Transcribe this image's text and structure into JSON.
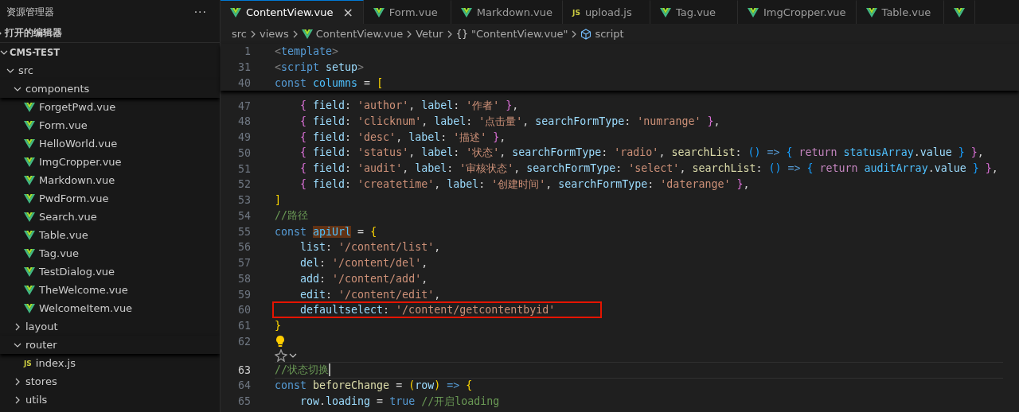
{
  "sidebar": {
    "title": "资源管理器",
    "more": "···",
    "sections": [
      {
        "label": "打开的编辑器",
        "expanded": false
      },
      {
        "label": "CMS-TEST",
        "expanded": true
      }
    ],
    "tree": [
      {
        "label": "src",
        "kind": "folder",
        "expanded": true,
        "children": [
          {
            "label": "components",
            "kind": "folder",
            "expanded": true,
            "children": [
              {
                "label": "ForgetPwd.vue",
                "kind": "vue"
              },
              {
                "label": "Form.vue",
                "kind": "vue"
              },
              {
                "label": "HelloWorld.vue",
                "kind": "vue"
              },
              {
                "label": "ImgCropper.vue",
                "kind": "vue"
              },
              {
                "label": "Markdown.vue",
                "kind": "vue"
              },
              {
                "label": "PwdForm.vue",
                "kind": "vue"
              },
              {
                "label": "Search.vue",
                "kind": "vue"
              },
              {
                "label": "Table.vue",
                "kind": "vue"
              },
              {
                "label": "Tag.vue",
                "kind": "vue"
              },
              {
                "label": "TestDialog.vue",
                "kind": "vue"
              },
              {
                "label": "TheWelcome.vue",
                "kind": "vue"
              },
              {
                "label": "WelcomeItem.vue",
                "kind": "vue"
              }
            ]
          },
          {
            "label": "layout",
            "kind": "folder",
            "expanded": false
          },
          {
            "label": "router",
            "kind": "folder",
            "expanded": true,
            "children": [
              {
                "label": "index.js",
                "kind": "js",
                "icon": "JS"
              }
            ]
          },
          {
            "label": "stores",
            "kind": "folder",
            "expanded": false
          },
          {
            "label": "utils",
            "kind": "folder",
            "expanded": false
          }
        ]
      }
    ]
  },
  "tabs": [
    {
      "label": "ContentView.vue",
      "kind": "vue",
      "selected": true,
      "close": "×"
    },
    {
      "label": "Form.vue",
      "kind": "vue",
      "selected": false
    },
    {
      "label": "Markdown.vue",
      "kind": "vue",
      "selected": false
    },
    {
      "label": "upload.js",
      "kind": "js",
      "icon": "JS",
      "selected": false
    },
    {
      "label": "Tag.vue",
      "kind": "vue",
      "selected": false
    },
    {
      "label": "ImgCropper.vue",
      "kind": "vue",
      "selected": false
    },
    {
      "label": "Table.vue",
      "kind": "vue",
      "selected": false
    },
    {
      "kind": "vue",
      "selected": false
    }
  ],
  "breadcrumb": [
    {
      "label": "src",
      "kind": "folder"
    },
    {
      "label": "views",
      "kind": "folder"
    },
    {
      "label": "ContentView.vue",
      "kind": "vue"
    },
    {
      "label": "Vetur",
      "kind": "plain"
    },
    {
      "label": "\"ContentView.vue\"",
      "kind": "object",
      "icon": "{}"
    },
    {
      "label": "script",
      "kind": "module"
    }
  ],
  "sticky": [
    {
      "number": "1",
      "tokens": [
        {
          "kind": "tag",
          "text": "<"
        },
        {
          "kind": "tn",
          "text": "template"
        },
        {
          "kind": "tag",
          "text": ">"
        }
      ]
    },
    {
      "number": "31",
      "tokens": [
        {
          "kind": "tag",
          "text": "<"
        },
        {
          "kind": "tn",
          "text": "script "
        },
        {
          "kind": "prop",
          "text": "setup"
        },
        {
          "kind": "tag",
          "text": ">"
        }
      ]
    },
    {
      "number": "40",
      "tokens": [
        {
          "kind": "kw",
          "text": "const "
        },
        {
          "kind": "var",
          "text": "columns"
        },
        {
          "kind": "punc",
          "text": " = "
        },
        {
          "kind": "b1",
          "text": "["
        }
      ]
    }
  ],
  "lines": [
    {
      "kind": "code",
      "number": "47",
      "tokens": [
        {
          "kind": "b2",
          "text": "    { "
        },
        {
          "kind": "prop",
          "text": "field"
        },
        {
          "kind": "punc",
          "text": ": "
        },
        {
          "kind": "str",
          "text": "'author'"
        },
        {
          "kind": "punc",
          "text": ", "
        },
        {
          "kind": "prop",
          "text": "label"
        },
        {
          "kind": "punc",
          "text": ": "
        },
        {
          "kind": "str",
          "text": "'作者'"
        },
        {
          "kind": "b2",
          "text": " }"
        },
        {
          "kind": "punc",
          "text": ","
        }
      ]
    },
    {
      "kind": "code",
      "number": "48",
      "tokens": [
        {
          "kind": "b2",
          "text": "    { "
        },
        {
          "kind": "prop",
          "text": "field"
        },
        {
          "kind": "punc",
          "text": ": "
        },
        {
          "kind": "str",
          "text": "'clicknum'"
        },
        {
          "kind": "punc",
          "text": ", "
        },
        {
          "kind": "prop",
          "text": "label"
        },
        {
          "kind": "punc",
          "text": ": "
        },
        {
          "kind": "str",
          "text": "'点击量'"
        },
        {
          "kind": "punc",
          "text": ", "
        },
        {
          "kind": "prop",
          "text": "searchFormType"
        },
        {
          "kind": "punc",
          "text": ": "
        },
        {
          "kind": "str",
          "text": "'numrange'"
        },
        {
          "kind": "b2",
          "text": " }"
        },
        {
          "kind": "punc",
          "text": ","
        }
      ]
    },
    {
      "kind": "code",
      "number": "49",
      "tokens": [
        {
          "kind": "b2",
          "text": "    { "
        },
        {
          "kind": "prop",
          "text": "field"
        },
        {
          "kind": "punc",
          "text": ": "
        },
        {
          "kind": "str",
          "text": "'desc'"
        },
        {
          "kind": "punc",
          "text": ", "
        },
        {
          "kind": "prop",
          "text": "label"
        },
        {
          "kind": "punc",
          "text": ": "
        },
        {
          "kind": "str",
          "text": "'描述'"
        },
        {
          "kind": "b2",
          "text": " }"
        },
        {
          "kind": "punc",
          "text": ","
        }
      ]
    },
    {
      "kind": "code",
      "number": "50",
      "tokens": [
        {
          "kind": "b2",
          "text": "    { "
        },
        {
          "kind": "prop",
          "text": "field"
        },
        {
          "kind": "punc",
          "text": ": "
        },
        {
          "kind": "str",
          "text": "'status'"
        },
        {
          "kind": "punc",
          "text": ", "
        },
        {
          "kind": "prop",
          "text": "label"
        },
        {
          "kind": "punc",
          "text": ": "
        },
        {
          "kind": "str",
          "text": "'状态'"
        },
        {
          "kind": "punc",
          "text": ", "
        },
        {
          "kind": "prop",
          "text": "searchFormType"
        },
        {
          "kind": "punc",
          "text": ": "
        },
        {
          "kind": "str",
          "text": "'radio'"
        },
        {
          "kind": "punc",
          "text": ", "
        },
        {
          "kind": "fn",
          "text": "searchList"
        },
        {
          "kind": "punc",
          "text": ": "
        },
        {
          "kind": "b3",
          "text": "()"
        },
        {
          "kind": "kw",
          "text": " => "
        },
        {
          "kind": "b3",
          "text": "{ "
        },
        {
          "kind": "ctl",
          "text": "return "
        },
        {
          "kind": "var",
          "text": "statusArray"
        },
        {
          "kind": "punc",
          "text": "."
        },
        {
          "kind": "prop",
          "text": "value"
        },
        {
          "kind": "b3",
          "text": " }"
        },
        {
          "kind": "b2",
          "text": " }"
        },
        {
          "kind": "punc",
          "text": ","
        }
      ]
    },
    {
      "kind": "code",
      "number": "51",
      "tokens": [
        {
          "kind": "b2",
          "text": "    { "
        },
        {
          "kind": "prop",
          "text": "field"
        },
        {
          "kind": "punc",
          "text": ": "
        },
        {
          "kind": "str",
          "text": "'audit'"
        },
        {
          "kind": "punc",
          "text": ", "
        },
        {
          "kind": "prop",
          "text": "label"
        },
        {
          "kind": "punc",
          "text": ": "
        },
        {
          "kind": "str",
          "text": "'审核状态'"
        },
        {
          "kind": "punc",
          "text": ", "
        },
        {
          "kind": "prop",
          "text": "searchFormType"
        },
        {
          "kind": "punc",
          "text": ": "
        },
        {
          "kind": "str",
          "text": "'select'"
        },
        {
          "kind": "punc",
          "text": ", "
        },
        {
          "kind": "fn",
          "text": "searchList"
        },
        {
          "kind": "punc",
          "text": ": "
        },
        {
          "kind": "b3",
          "text": "()"
        },
        {
          "kind": "kw",
          "text": " => "
        },
        {
          "kind": "b3",
          "text": "{ "
        },
        {
          "kind": "ctl",
          "text": "return "
        },
        {
          "kind": "var",
          "text": "auditArray"
        },
        {
          "kind": "punc",
          "text": "."
        },
        {
          "kind": "prop",
          "text": "value"
        },
        {
          "kind": "b3",
          "text": " }"
        },
        {
          "kind": "b2",
          "text": " }"
        },
        {
          "kind": "punc",
          "text": ","
        }
      ]
    },
    {
      "kind": "code",
      "number": "52",
      "tokens": [
        {
          "kind": "b2",
          "text": "    { "
        },
        {
          "kind": "prop",
          "text": "field"
        },
        {
          "kind": "punc",
          "text": ": "
        },
        {
          "kind": "str",
          "text": "'createtime'"
        },
        {
          "kind": "punc",
          "text": ", "
        },
        {
          "kind": "prop",
          "text": "label"
        },
        {
          "kind": "punc",
          "text": ": "
        },
        {
          "kind": "str",
          "text": "'创建时间'"
        },
        {
          "kind": "punc",
          "text": ", "
        },
        {
          "kind": "prop",
          "text": "searchFormType"
        },
        {
          "kind": "punc",
          "text": ": "
        },
        {
          "kind": "str",
          "text": "'daterange'"
        },
        {
          "kind": "b2",
          "text": " }"
        },
        {
          "kind": "punc",
          "text": ","
        }
      ]
    },
    {
      "kind": "code",
      "number": "53",
      "tokens": [
        {
          "kind": "b1",
          "text": "]"
        }
      ]
    },
    {
      "kind": "code",
      "number": "54",
      "tokens": [
        {
          "kind": "cm",
          "text": "//路径"
        }
      ]
    },
    {
      "kind": "code",
      "number": "55",
      "tokens": [
        {
          "kind": "kw",
          "text": "const "
        },
        {
          "kind": "var",
          "text": "apiUrl",
          "highlighted": true
        },
        {
          "kind": "punc",
          "text": " = "
        },
        {
          "kind": "b1",
          "text": "{"
        }
      ]
    },
    {
      "kind": "code",
      "number": "56",
      "tokens": [
        {
          "kind": "prop",
          "text": "    list"
        },
        {
          "kind": "punc",
          "text": ": "
        },
        {
          "kind": "str",
          "text": "'/content/list'"
        },
        {
          "kind": "punc",
          "text": ","
        }
      ]
    },
    {
      "kind": "code",
      "number": "57",
      "tokens": [
        {
          "kind": "prop",
          "text": "    del"
        },
        {
          "kind": "punc",
          "text": ": "
        },
        {
          "kind": "str",
          "text": "'/content/del'"
        },
        {
          "kind": "punc",
          "text": ","
        }
      ]
    },
    {
      "kind": "code",
      "number": "58",
      "tokens": [
        {
          "kind": "prop",
          "text": "    add"
        },
        {
          "kind": "punc",
          "text": ": "
        },
        {
          "kind": "str",
          "text": "'/content/add'"
        },
        {
          "kind": "punc",
          "text": ","
        }
      ]
    },
    {
      "kind": "code",
      "number": "59",
      "tokens": [
        {
          "kind": "prop",
          "text": "    edit"
        },
        {
          "kind": "punc",
          "text": ": "
        },
        {
          "kind": "str",
          "text": "'/content/edit'"
        },
        {
          "kind": "punc",
          "text": ","
        }
      ]
    },
    {
      "kind": "code",
      "number": "60",
      "boxed": true,
      "tokens": [
        {
          "kind": "prop",
          "text": "    defaultselect"
        },
        {
          "kind": "punc",
          "text": ": "
        },
        {
          "kind": "str",
          "text": "'/content/getcontentbyid'"
        }
      ]
    },
    {
      "kind": "code",
      "number": "61",
      "tokens": [
        {
          "kind": "b1",
          "text": "}"
        }
      ]
    },
    {
      "kind": "code",
      "number": "62",
      "lightbulb": true
    },
    {
      "kind": "lens"
    },
    {
      "kind": "code",
      "number": "63",
      "current": true,
      "tokens": [
        {
          "kind": "cm",
          "text": "//状态切换"
        }
      ]
    },
    {
      "kind": "code",
      "number": "64",
      "tokens": [
        {
          "kind": "kw",
          "text": "const "
        },
        {
          "kind": "fn",
          "text": "beforeChange"
        },
        {
          "kind": "punc",
          "text": " = "
        },
        {
          "kind": "b1",
          "text": "("
        },
        {
          "kind": "prop",
          "text": "row"
        },
        {
          "kind": "b1",
          "text": ")"
        },
        {
          "kind": "kw",
          "text": " => "
        },
        {
          "kind": "b1",
          "text": "{"
        }
      ]
    },
    {
      "kind": "code",
      "number": "65",
      "tokens": [
        {
          "kind": "prop",
          "text": "    row"
        },
        {
          "kind": "punc",
          "text": "."
        },
        {
          "kind": "prop",
          "text": "loading"
        },
        {
          "kind": "punc",
          "text": " = "
        },
        {
          "kind": "kw",
          "text": "true "
        },
        {
          "kind": "cm",
          "text": "//开启loading"
        }
      ]
    }
  ]
}
